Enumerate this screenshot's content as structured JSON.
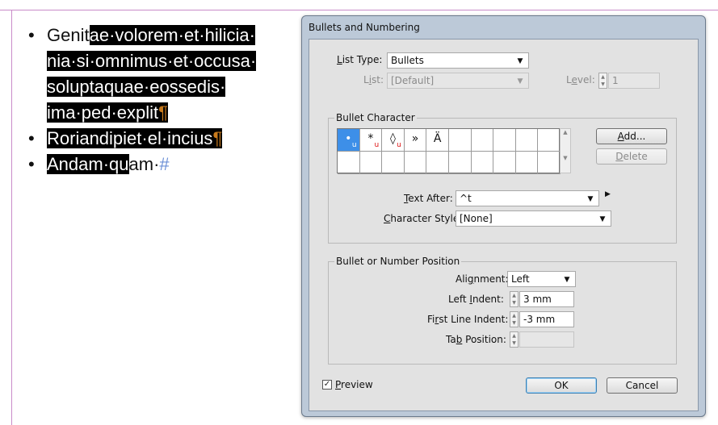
{
  "document": {
    "bullets": [
      {
        "glyph": "•",
        "lines": [
          {
            "plain": "Genit",
            "hl": "ae·volorem·et·hilicia·"
          },
          {
            "plain": "",
            "hl": "nia·si·omnimus·et·occusa·"
          },
          {
            "plain": "",
            "hl": "soluptaquae·eossedis·"
          },
          {
            "plain": "",
            "hl": "ima·ped·explit",
            "mark": "¶"
          }
        ]
      },
      {
        "glyph": "•",
        "lines": [
          {
            "plain": "",
            "hl": "Roriandipiet·el·incius",
            "mark": "¶"
          }
        ]
      },
      {
        "glyph": "•",
        "lines": [
          {
            "plain": "",
            "hl": "Andam·qu",
            "tail": "am·",
            "end": "#"
          }
        ]
      }
    ]
  },
  "dialog": {
    "title": "Bullets and Numbering",
    "list_type": {
      "label": "List Type:",
      "value": "Bullets"
    },
    "list": {
      "label": "List:",
      "value": "[Default]"
    },
    "level": {
      "label": "Level:",
      "value": "1"
    },
    "bullet_character": {
      "title": "Bullet Character",
      "glyphs": [
        {
          "char": "•",
          "u": "u"
        },
        {
          "char": "*",
          "u": "u"
        },
        {
          "char": "◊",
          "u": "u"
        },
        {
          "char": "»",
          "u": ""
        },
        {
          "char": "Ä",
          "u": ""
        },
        {
          "char": "",
          "u": ""
        },
        {
          "char": "",
          "u": ""
        },
        {
          "char": "",
          "u": ""
        },
        {
          "char": "",
          "u": ""
        },
        {
          "char": "",
          "u": ""
        },
        {
          "char": "",
          "u": ""
        },
        {
          "char": "",
          "u": ""
        },
        {
          "char": "",
          "u": ""
        },
        {
          "char": "",
          "u": ""
        },
        {
          "char": "",
          "u": ""
        },
        {
          "char": "",
          "u": ""
        },
        {
          "char": "",
          "u": ""
        },
        {
          "char": "",
          "u": ""
        },
        {
          "char": "",
          "u": ""
        },
        {
          "char": "",
          "u": ""
        }
      ],
      "add_label": "Add...",
      "delete_label": "Delete",
      "text_after": {
        "label": "Text After:",
        "value": "^t"
      },
      "character_style": {
        "label": "Character Style:",
        "value": "[None]"
      }
    },
    "position": {
      "title": "Bullet or Number Position",
      "alignment": {
        "label": "Alignment:",
        "value": "Left"
      },
      "left_indent": {
        "label": "Left Indent:",
        "value": "3 mm"
      },
      "first_line_indent": {
        "label": "First Line Indent:",
        "value": "-3 mm"
      },
      "tab_position": {
        "label": "Tab Position:",
        "value": ""
      }
    },
    "preview": {
      "label": "Preview",
      "checked": "✓"
    },
    "ok_label": "OK",
    "cancel_label": "Cancel"
  }
}
